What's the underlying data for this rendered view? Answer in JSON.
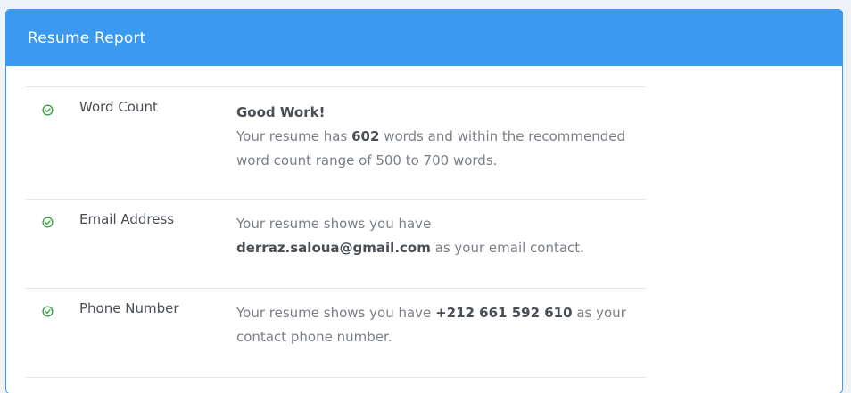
{
  "header": {
    "title": "Resume Report"
  },
  "colors": {
    "header_bg": "#3b99f0",
    "check_green": "#2e9e3a",
    "text_dark": "#4a4f55",
    "text_muted": "#7a7f86"
  },
  "rows": [
    {
      "icon": "check-circle-icon",
      "label": "Word Count",
      "heading": "Good Work!",
      "text_before": "Your resume has",
      "value": "602",
      "text_after": "words and within the recommended word count range of 500 to 700 words."
    },
    {
      "icon": "check-circle-icon",
      "label": "Email Address",
      "text_before": "Your resume shows you have",
      "value": "derraz.saloua@gmail.com",
      "text_after": "as your email contact."
    },
    {
      "icon": "check-circle-icon",
      "label": "Phone Number",
      "text_before": "Your resume shows you have",
      "value": "+212 661 592 610",
      "text_after": "as your contact phone number."
    }
  ]
}
